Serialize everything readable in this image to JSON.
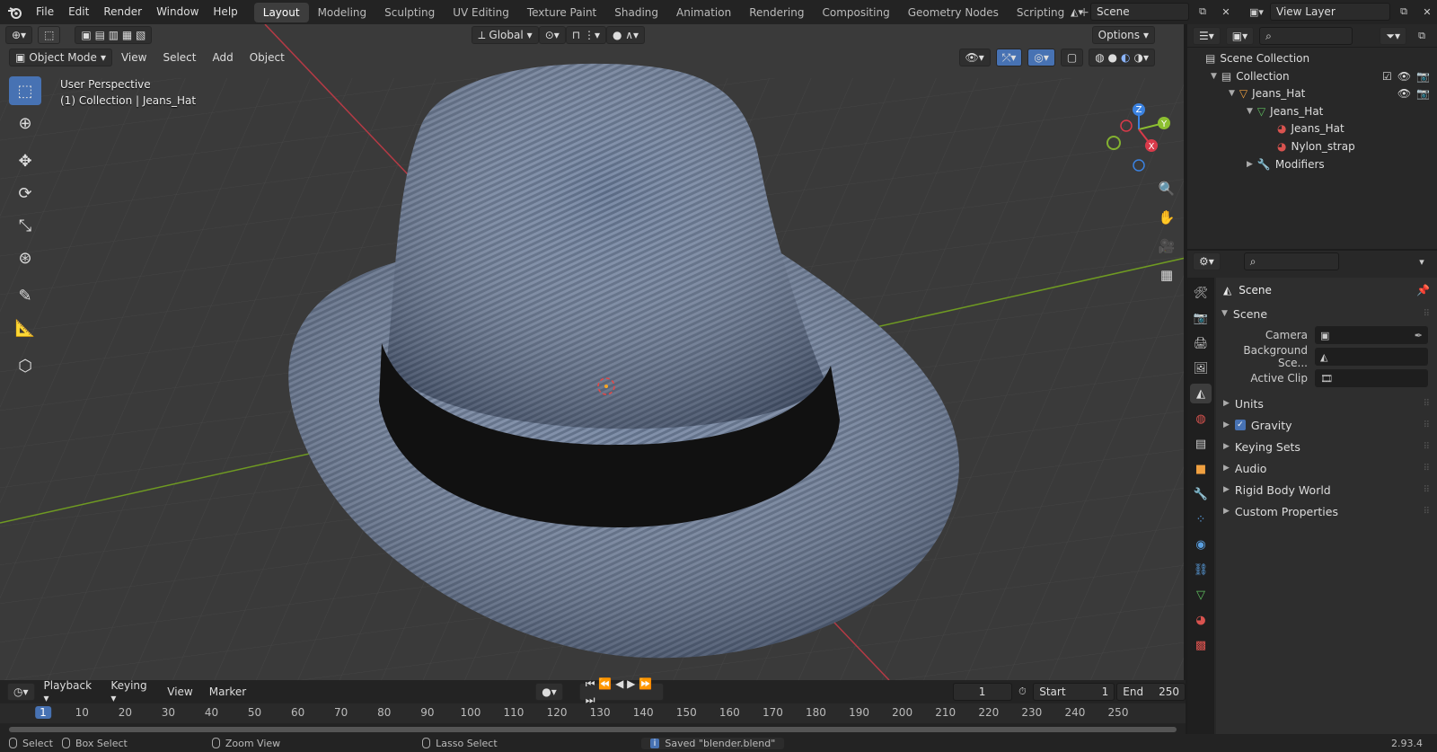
{
  "menu": [
    "File",
    "Edit",
    "Render",
    "Window",
    "Help"
  ],
  "workspaces": [
    {
      "label": "Layout",
      "active": true
    },
    {
      "label": "Modeling"
    },
    {
      "label": "Sculpting"
    },
    {
      "label": "UV Editing"
    },
    {
      "label": "Texture Paint"
    },
    {
      "label": "Shading"
    },
    {
      "label": "Animation"
    },
    {
      "label": "Rendering"
    },
    {
      "label": "Compositing"
    },
    {
      "label": "Geometry Nodes"
    },
    {
      "label": "Scripting"
    }
  ],
  "scene_field": "Scene",
  "view_layer_field": "View Layer",
  "viewport": {
    "transform_orientation": "Global",
    "options_label": "Options",
    "mode": "Object Mode",
    "menus": [
      "View",
      "Select",
      "Add",
      "Object"
    ],
    "perspective": "User Perspective",
    "collection_info": "(1) Collection | Jeans_Hat",
    "gizmo": {
      "z": "Z",
      "y": "Y",
      "x": "X"
    }
  },
  "outliner": {
    "rows": [
      {
        "label": "Scene Collection",
        "indent": 0
      },
      {
        "label": "Collection",
        "indent": 1
      },
      {
        "label": "Jeans_Hat",
        "indent": 2
      },
      {
        "label": "Jeans_Hat",
        "indent": 3
      },
      {
        "label": "Jeans_Hat",
        "indent": 4
      },
      {
        "label": "Nylon_strap",
        "indent": 4
      },
      {
        "label": "Modifiers",
        "indent": 3
      }
    ]
  },
  "properties": {
    "context_title": "Scene",
    "panel_title": "Scene",
    "fields": [
      {
        "label": "Camera",
        "value": ""
      },
      {
        "label": "Background Sce...",
        "value": ""
      },
      {
        "label": "Active Clip",
        "value": ""
      }
    ],
    "subpanels": [
      {
        "label": "Units",
        "checkbox": false
      },
      {
        "label": "Gravity",
        "checkbox": true
      },
      {
        "label": "Keying Sets",
        "checkbox": false
      },
      {
        "label": "Audio",
        "checkbox": false
      },
      {
        "label": "Rigid Body World",
        "checkbox": false
      },
      {
        "label": "Custom Properties",
        "checkbox": false
      }
    ]
  },
  "timeline": {
    "menus": [
      "Playback",
      "Keying",
      "View",
      "Marker"
    ],
    "current_frame": "1",
    "start_label": "Start",
    "start": "1",
    "end_label": "End",
    "end": "250",
    "ticks": [
      "1",
      "10",
      "20",
      "30",
      "40",
      "50",
      "60",
      "70",
      "80",
      "90",
      "100",
      "110",
      "120",
      "130",
      "140",
      "150",
      "160",
      "170",
      "180",
      "190",
      "200",
      "210",
      "220",
      "230",
      "240",
      "250"
    ]
  },
  "status": {
    "select": "Select",
    "box_select": "Box Select",
    "zoom_view": "Zoom View",
    "lasso_select": "Lasso Select",
    "message": "Saved \"blender.blend\"",
    "version": "2.93.4"
  },
  "colors": {
    "accent": "#4772b3",
    "x_axis": "#d93a4a",
    "y_axis": "#8cbf30",
    "z_axis": "#3b82e0"
  }
}
